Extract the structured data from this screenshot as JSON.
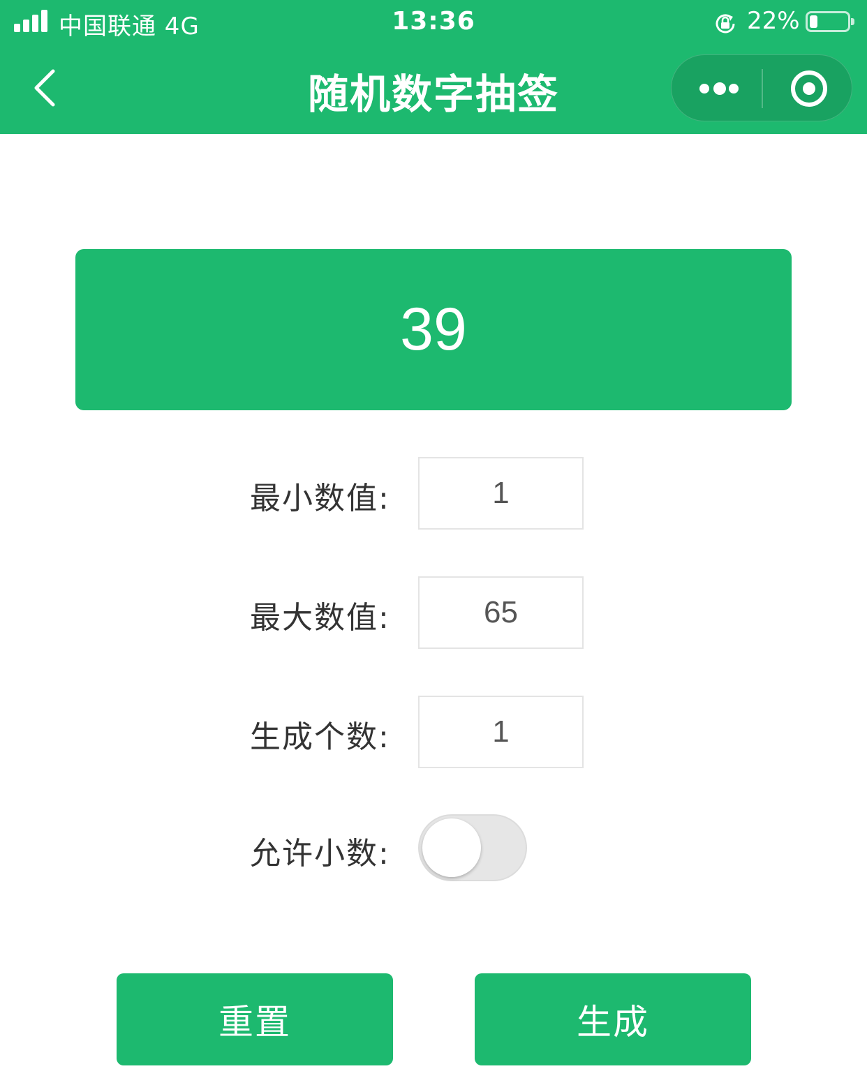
{
  "status_bar": {
    "carrier": "中国联通  4G",
    "time": "13:36",
    "battery": "22%",
    "battery_level": 0.22
  },
  "nav": {
    "title": "随机数字抽签",
    "back_icon": "chevron-left-icon",
    "more_icon": "more-dots-icon",
    "close_icon": "target-close-icon"
  },
  "result": {
    "value": "39"
  },
  "form": {
    "min_label": "最小数值:",
    "min_value": "1",
    "max_label": "最大数值:",
    "max_value": "65",
    "count_label": "生成个数:",
    "count_value": "1",
    "decimal_label": "允许小数:",
    "decimal_enabled": false
  },
  "actions": {
    "reset_label": "重置",
    "generate_label": "生成"
  },
  "colors": {
    "accent": "#1db96f",
    "toggle_off": "#e6e6e6"
  }
}
